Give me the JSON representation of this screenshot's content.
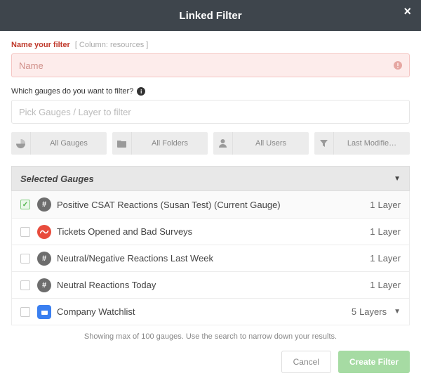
{
  "header": {
    "title": "Linked Filter"
  },
  "filterName": {
    "label": "Name your filter",
    "subLabel": "[ Column: resources ]",
    "placeholder": "Name",
    "value": ""
  },
  "question": "Which gauges do you want to filter?",
  "pickPlaceholder": "Pick Gauges / Layer to filter",
  "filterButtons": [
    {
      "icon": "pie-icon",
      "label": "All Gauges"
    },
    {
      "icon": "folder-icon",
      "label": "All Folders"
    },
    {
      "icon": "user-icon",
      "label": "All Users"
    },
    {
      "icon": "funnel-icon",
      "label": "Last Modifie…"
    }
  ],
  "selectedHeader": "Selected Gauges",
  "gauges": [
    {
      "checked": true,
      "iconKind": "hash",
      "name": "Positive CSAT Reactions (Susan Test) (Current Gauge)",
      "count": "1",
      "unit": "Layer",
      "expandable": false
    },
    {
      "checked": false,
      "iconKind": "red",
      "name": "Tickets Opened and Bad Surveys",
      "count": "1",
      "unit": "Layer",
      "expandable": false
    },
    {
      "checked": false,
      "iconKind": "hash",
      "name": "Neutral/Negative Reactions Last Week",
      "count": "1",
      "unit": "Layer",
      "expandable": false
    },
    {
      "checked": false,
      "iconKind": "hash",
      "name": "Neutral Reactions Today",
      "count": "1",
      "unit": "Layer",
      "expandable": false
    },
    {
      "checked": false,
      "iconKind": "blue",
      "name": "Company Watchlist",
      "count": "5",
      "unit": "Layers",
      "expandable": true
    }
  ],
  "footerNote": "Showing max of 100 gauges. Use the search to narrow down your results.",
  "buttons": {
    "cancel": "Cancel",
    "create": "Create Filter"
  }
}
